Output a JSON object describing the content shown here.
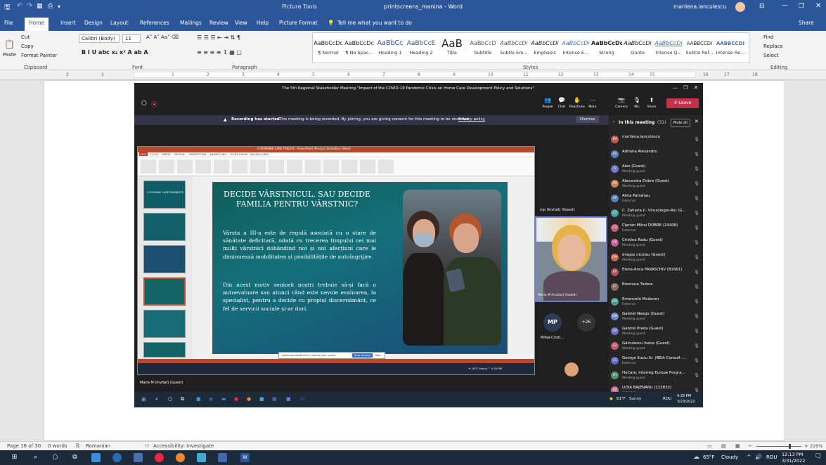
{
  "word": {
    "qat_icons": [
      "save-icon",
      "undo-icon",
      "redo-icon",
      "view-icon",
      "preview-icon"
    ],
    "tools_label": "Picture Tools",
    "doc_title": "printscreens_manina - Word",
    "user": "marilena.ianculescu",
    "menu": [
      "File",
      "Home",
      "Insert",
      "Design",
      "Layout",
      "References",
      "Mailings",
      "Review",
      "View",
      "Help",
      "Picture Format"
    ],
    "tell_me": "Tell me what you want to do",
    "share": "Share",
    "clipboard": {
      "cut": "Cut",
      "copy": "Copy",
      "paste": "Paste",
      "format_painter": "Format Painter",
      "label": "Clipboard"
    },
    "font": {
      "name": "Calibri (Body)",
      "size": "11",
      "label": "Font"
    },
    "paragraph_label": "Paragraph",
    "styles_label": "Styles",
    "styles": [
      {
        "sample": "AaBbCcDc",
        "name": "¶ Normal"
      },
      {
        "sample": "AaBbCcDc",
        "name": "¶ No Spac..."
      },
      {
        "sample": "AaBbCc",
        "name": "Heading 1"
      },
      {
        "sample": "AaBbCcE",
        "name": "Heading 2"
      },
      {
        "sample": "AaB",
        "name": "Title"
      },
      {
        "sample": "AaBbCcD",
        "name": "Subtitle"
      },
      {
        "sample": "AaBbCcDi",
        "name": "Subtle Em..."
      },
      {
        "sample": "AaBbCcDi",
        "name": "Emphasis"
      },
      {
        "sample": "AaBbCcDi",
        "name": "Intense E..."
      },
      {
        "sample": "AaBbCcDc",
        "name": "Strong"
      },
      {
        "sample": "AaBbCcDi",
        "name": "Quote"
      },
      {
        "sample": "AaBbCcDi",
        "name": "Intense Q..."
      },
      {
        "sample": "AABBCCDI",
        "name": "Subtle Ref..."
      },
      {
        "sample": "AABBCCDI",
        "name": "Intense Re..."
      }
    ],
    "editing": {
      "find": "Find",
      "replace": "Replace",
      "select": "Select",
      "label": "Editing"
    },
    "ruler_numbers": [
      "2",
      "1",
      "1",
      "2",
      "3",
      "4",
      "5",
      "6",
      "7",
      "8",
      "9",
      "10",
      "11",
      "12",
      "13",
      "14",
      "15",
      "16",
      "17",
      "18"
    ],
    "status": {
      "page": "Page 18 of 30",
      "words": "0 words",
      "lang": "Romanian",
      "access": "Accessibility: Investigate",
      "zoom": "220%"
    }
  },
  "teams": {
    "meeting_title": "The 5th Regional Stakeholder Meeting \"Impact of the COVID-19 Pandemic Crisis on Home Care Development Policy and Solutions\"",
    "toolbar": [
      {
        "icon": "people-icon",
        "label": "People"
      },
      {
        "icon": "chat-icon",
        "label": "Chat"
      },
      {
        "icon": "reactions-icon",
        "label": "Reactions"
      },
      {
        "icon": "more-icon",
        "label": "More"
      },
      {
        "icon": "camera-icon",
        "label": "Camera"
      },
      {
        "icon": "mic-icon",
        "label": "Mic"
      },
      {
        "icon": "share-icon",
        "label": "Share"
      }
    ],
    "leave": "Leave",
    "banner": {
      "bold": "Recording has started.",
      "text": "This meeting is being recorded. By joining, you are giving consent for this meeting to be recorded.",
      "link": "Privacy policy",
      "dismiss": "Dismiss"
    },
    "panel": {
      "title": "In this meeting",
      "count": "(31)",
      "mute_all": "Mute all"
    },
    "participants": [
      {
        "initials": "MI",
        "name": "marilena.ianculescu",
        "sub": "",
        "color": "#c45c4a"
      },
      {
        "initials": "AA",
        "name": "Adriana Alexandru",
        "sub": "",
        "color": "#5a7fb8"
      },
      {
        "initials": "A",
        "name": "Alex (Guest)",
        "sub": "Meeting guest",
        "color": "#6b80c8"
      },
      {
        "initials": "AD",
        "name": "Alexandra Dobre (Guest)",
        "sub": "Meeting guest",
        "color": "#c8825a"
      },
      {
        "initials": "AP",
        "name": "Alina Patrahau",
        "sub": "External",
        "color": "#5a7fb8"
      },
      {
        "initials": "CZ",
        "name": "C. Zaharia (I. Virusologie-Ro) (G...",
        "sub": "Meeting guest",
        "color": "#4aa0a0"
      },
      {
        "initials": "CD",
        "name": "Ciprian Mihai DOBRE (24408)",
        "sub": "External",
        "color": "#c45c7a"
      },
      {
        "initials": "CR",
        "name": "Cristina Radu (Guest)",
        "sub": "Meeting guest",
        "color": "#c45ca0"
      },
      {
        "initials": "DN",
        "name": "dragos nicolau (Guest)",
        "sub": "Meeting guest",
        "color": "#c86a4a"
      },
      {
        "initials": "EP",
        "name": "Elena-Anca PARASCHIV (81661)",
        "sub": "",
        "color": "#b8505a"
      },
      {
        "initials": "ET",
        "name": "Eleonora Tudora",
        "sub": "",
        "color": "#8a6a5a"
      },
      {
        "initials": "EM",
        "name": "Emanuela Modoran",
        "sub": "External",
        "color": "#4a9a8a"
      },
      {
        "initials": "GN",
        "name": "Gabriel Neagu (Guest)",
        "sub": "Meeting guest",
        "color": "#6a8ac8"
      },
      {
        "initials": "GP",
        "name": "Gabriel Prada (Guest)",
        "sub": "Meeting guest",
        "color": "#6a70c8"
      },
      {
        "initials": "GI",
        "name": "Găiculescu Ioana (Guest)",
        "sub": "Meeting guest",
        "color": "#c85a70"
      },
      {
        "initials": "GS",
        "name": "George Suciu Sr. (BEIA Consult -...",
        "sub": "External",
        "color": "#5a6ac8"
      },
      {
        "initials": "HI",
        "name": "HoCare, Interreg Europe Progra...",
        "sub": "Meeting guest",
        "color": "#4a9a70"
      },
      {
        "initials": "LB",
        "name": "LIDIA BAJENARU (122832)",
        "sub": "External",
        "color": "#c86a8a"
      }
    ],
    "video_caption": "mp (Invitat) (Guest)",
    "video_caption2": "Maria M (Invitat) (Guest)",
    "mp_initials": "MP",
    "more_count": "+26",
    "mp_name": "Mihai-Cristi...",
    "shared_by": "Maria M (Invitat) (Guest)",
    "inner_tray": {
      "temp": "61°F",
      "weather": "Sunny",
      "lang": "ROU",
      "time": "4:33 PM",
      "date": "3/23/2022"
    }
  },
  "ppt": {
    "title": "O ROMANIE CARE TRIESTE - PowerPoint (Product Activation Failed)",
    "tabs": [
      "FILE",
      "HOME",
      "INSERT",
      "DESIGN",
      "TRANSITIONS",
      "ANIMATIONS",
      "SLIDE SHOW",
      "REVIEW",
      "VIEW"
    ],
    "thumb_text": "O ROMANIE CARE ÎNGRIJEȘTE",
    "sharing_msg": "teams.microsoft.com is sharing your screen.",
    "stop_sharing": "Stop sharing",
    "hide": "Hide",
    "slide": {
      "title": "DECIDE VÂRSTNICUL, SAU DECIDE FAMILIA PENTRU VÂRSTNIC?",
      "p1": "Vârsta a III-a este de regulă asociată cu o stare de sănătate deficitară, odată cu trecerea timpului cei mai mulți vârstnici dobândind noi și noi afecțiuni care le diminuează mobilitatea și posibilitățile de autoîngrijire.",
      "p2": "Din acest motiv seniorii noștri trebuie să-și facă o autoevaluare sau atunci când este nevoie evaluarea, la specialist, pentru a decide cu propiul discernământ, ce fel de servicii sociale și-ar dori."
    }
  },
  "tray": {
    "temp": "65°F",
    "weather": "Cloudy",
    "lang": "ROU",
    "time": "12:13 PM",
    "date": "3/31/2022"
  },
  "colors": {
    "word_blue": "#2b579a",
    "leave_red": "#c4314b",
    "slide_teal": "#14707a"
  }
}
